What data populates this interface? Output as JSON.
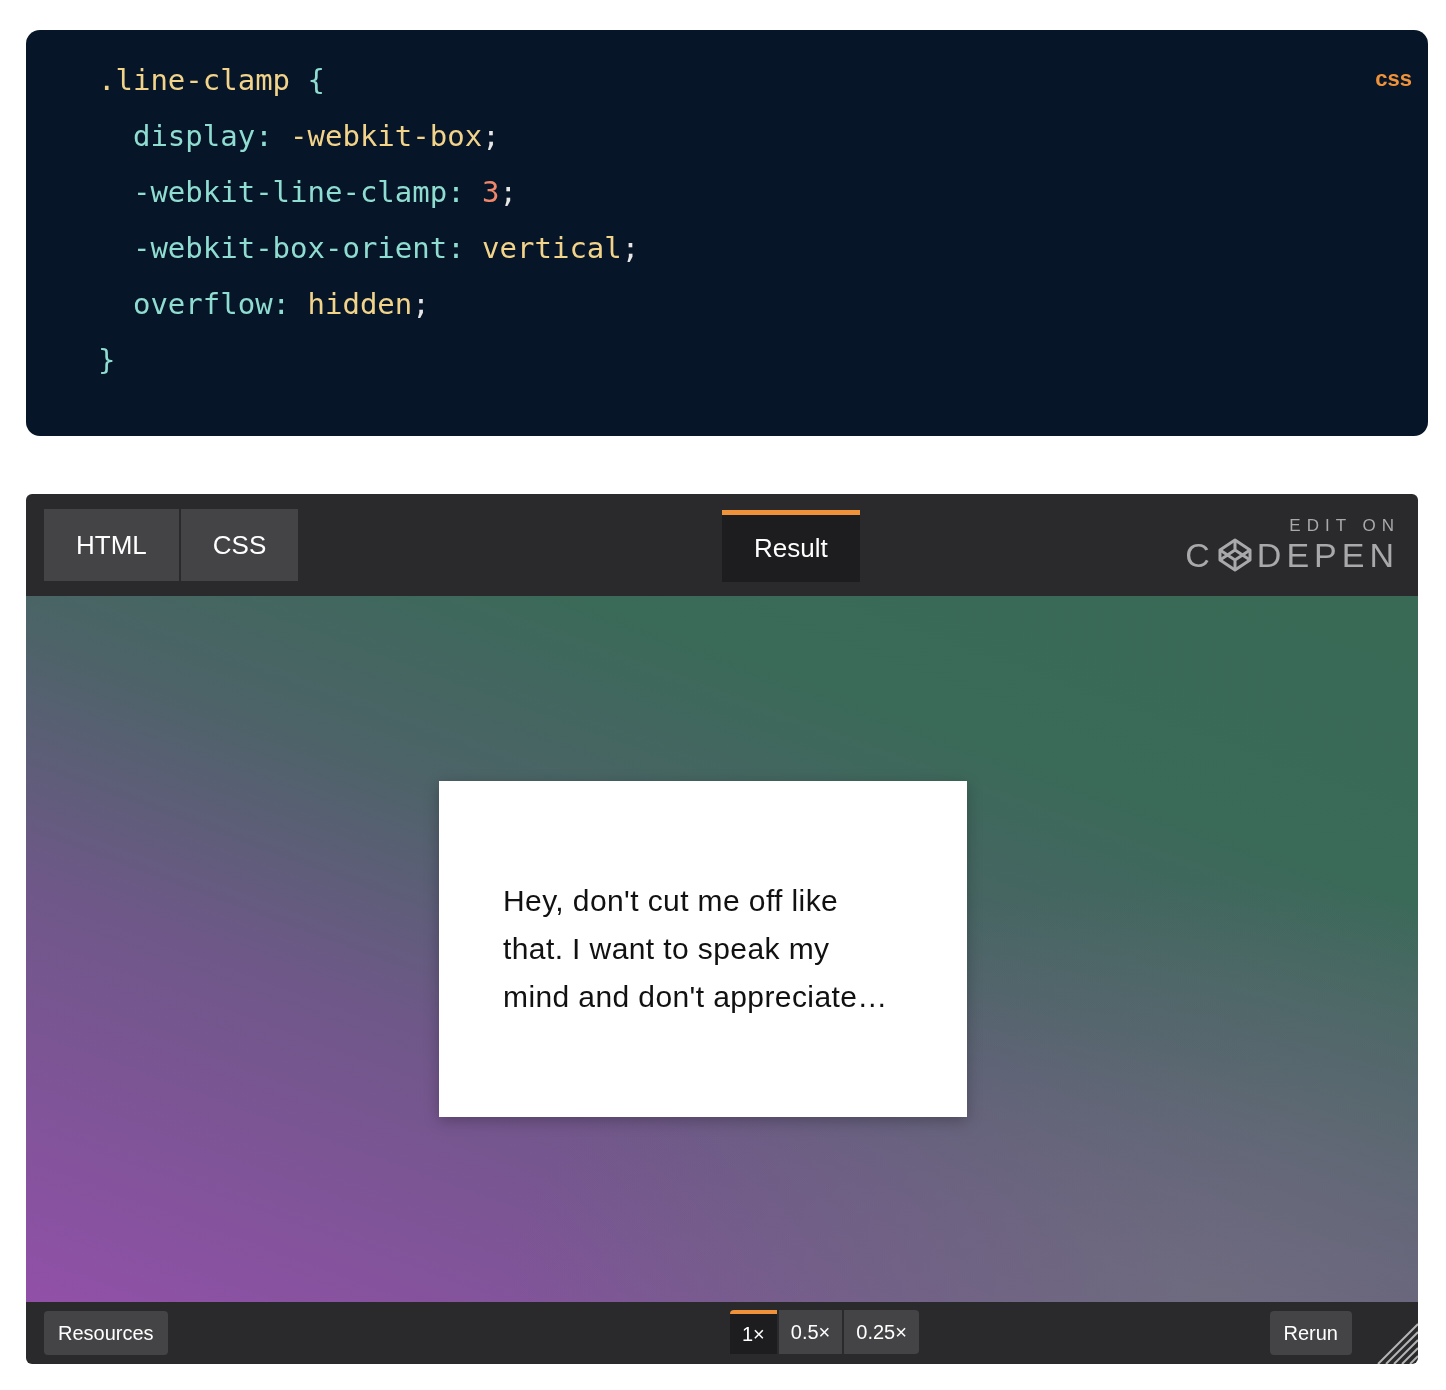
{
  "code_block": {
    "language": "css",
    "lines": [
      {
        "tokens": [
          {
            "kind": "selector",
            "text": ".line-clamp "
          },
          {
            "kind": "punct",
            "text": "{"
          }
        ]
      },
      {
        "tokens": [
          {
            "kind": "property",
            "text": "  display: "
          },
          {
            "kind": "value",
            "text": "-webkit-box"
          },
          {
            "kind": "plain",
            "text": ";"
          }
        ]
      },
      {
        "tokens": [
          {
            "kind": "property",
            "text": "  -webkit-line-clamp: "
          },
          {
            "kind": "number",
            "text": "3"
          },
          {
            "kind": "plain",
            "text": ";"
          }
        ]
      },
      {
        "tokens": [
          {
            "kind": "property",
            "text": "  -webkit-box-orient: "
          },
          {
            "kind": "value",
            "text": "vertical"
          },
          {
            "kind": "plain",
            "text": ";"
          }
        ]
      },
      {
        "tokens": [
          {
            "kind": "property",
            "text": "  overflow: "
          },
          {
            "kind": "value",
            "text": "hidden"
          },
          {
            "kind": "plain",
            "text": ";"
          }
        ]
      },
      {
        "tokens": [
          {
            "kind": "punct",
            "text": "}"
          }
        ]
      }
    ]
  },
  "embed": {
    "code_tabs": [
      {
        "label": "HTML",
        "selected": false
      },
      {
        "label": "CSS",
        "selected": false
      }
    ],
    "result_tab": {
      "label": "Result",
      "selected": true
    },
    "brand": {
      "caption": "EDIT ON",
      "name_start": "C",
      "name_end": "DEPEN"
    },
    "result": {
      "card_text": "Hey, don't cut me off like that. I want to speak my mind and don't appreciate…"
    },
    "footer": {
      "resources": "Resources",
      "zoom": [
        {
          "label": "1×",
          "selected": true
        },
        {
          "label": "0.5×",
          "selected": false
        },
        {
          "label": "0.25×",
          "selected": false
        }
      ],
      "rerun": "Rerun"
    }
  }
}
